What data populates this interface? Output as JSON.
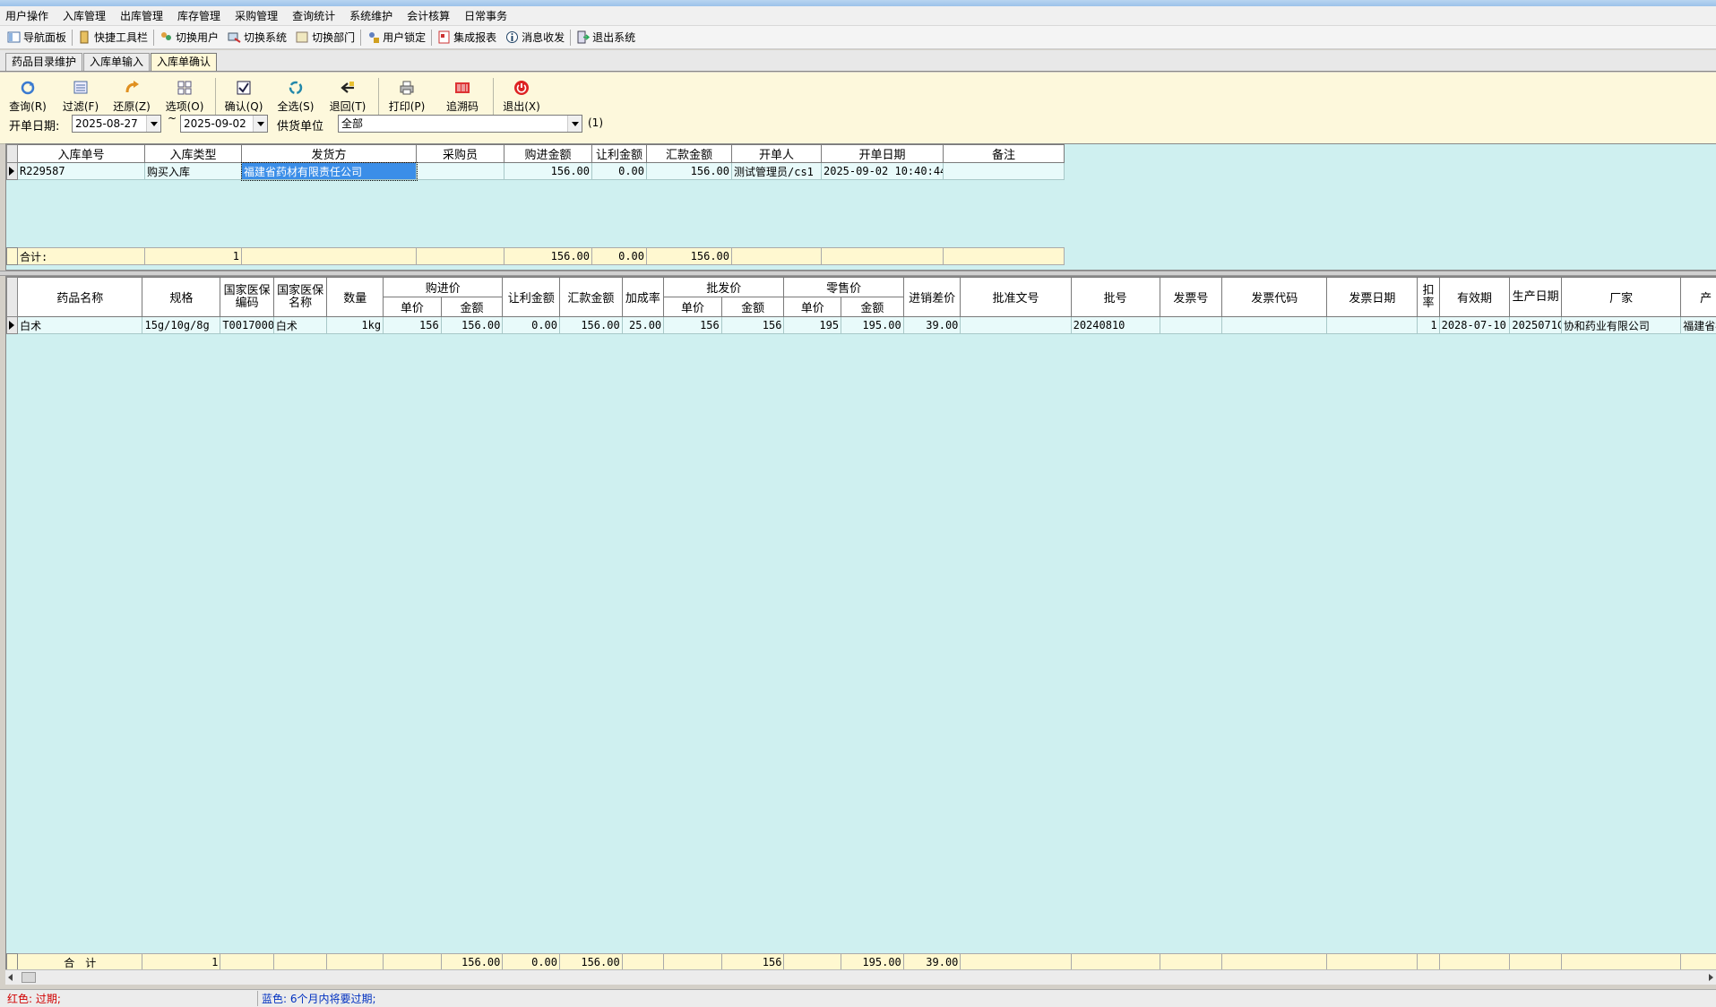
{
  "menu": [
    "用户操作",
    "入库管理",
    "出库管理",
    "库存管理",
    "采购管理",
    "查询统计",
    "系统维护",
    "会计核算",
    "日常事务"
  ],
  "quickbar": [
    {
      "label": "导航面板",
      "icon": "navigation-panel-icon"
    },
    {
      "label": "快捷工具栏",
      "icon": "toolbar-icon"
    },
    {
      "label": "切换用户",
      "icon": "switch-user-icon"
    },
    {
      "label": "切换系统",
      "icon": "switch-system-icon"
    },
    {
      "label": "切换部门",
      "icon": "switch-department-icon"
    },
    {
      "label": "用户锁定",
      "icon": "user-lock-icon"
    },
    {
      "label": "集成报表",
      "icon": "report-icon"
    },
    {
      "label": "消息收发",
      "icon": "message-icon"
    },
    {
      "label": "退出系统",
      "icon": "exit-system-icon"
    }
  ],
  "tabs": [
    "药品目录维护",
    "入库单输入",
    "入库单确认"
  ],
  "toolbar": {
    "query": "查询(R)",
    "filter": "过滤(F)",
    "restore": "还原(Z)",
    "options": "选项(O)",
    "confirm": "确认(Q)",
    "select_all": "全选(S)",
    "return": "退回(T)",
    "print": "打印(P)",
    "trace": "追溯码",
    "exit": "退出(X)"
  },
  "filter": {
    "date_label": "开单日期:",
    "date_from": "2025-08-27",
    "tilde": "~",
    "date_to": "2025-09-02",
    "supplier_label": "供货单位",
    "supplier_value": "全部",
    "count": "(1)"
  },
  "master": {
    "headers": [
      "入库单号",
      "入库类型",
      "发货方",
      "采购员",
      "购进金额",
      "让利金额",
      "汇款金额",
      "开单人",
      "开单日期",
      "备注"
    ],
    "rows": [
      {
        "no": "R229587",
        "type": "购买入库",
        "shipper": "福建省药材有限责任公司",
        "buyer": "",
        "purchase": "156.00",
        "discount": "0.00",
        "remit": "156.00",
        "issuer": "测试管理员/cs1",
        "date": "2025-09-02 10:40:44",
        "note": ""
      }
    ],
    "footer": {
      "label": "合计:",
      "count": "1",
      "purchase": "156.00",
      "discount": "0.00",
      "remit": "156.00"
    }
  },
  "detail": {
    "headers": {
      "name": "药品名称",
      "spec": "规格",
      "nhsa_code": "国家医保编码",
      "nhsa_name": "国家医保名称",
      "qty": "数量",
      "purchase_price": "购进价",
      "unit": "单价",
      "amount": "金额",
      "discount": "让利金额",
      "remit": "汇款金额",
      "markup": "加成率",
      "wholesale": "批发价",
      "retail": "零售价",
      "diff": "进销差价",
      "approval": "批准文号",
      "batch": "批号",
      "invoice_no": "发票号",
      "invoice_code": "发票代码",
      "invoice_date": "发票日期",
      "rate": "扣率",
      "expiry": "有效期",
      "mfg_date": "生产日期",
      "manufacturer": "厂家",
      "last": "产"
    },
    "rows": [
      {
        "name": "白术",
        "spec": "15g/10g/8g",
        "nhsa_code": "T0017000",
        "nhsa_name": "白术",
        "qty": "1kg",
        "pp_unit": "156",
        "pp_amount": "156.00",
        "discount": "0.00",
        "remit": "156.00",
        "markup": "25.00",
        "ws_unit": "156",
        "ws_amount": "156",
        "rt_unit": "195",
        "rt_amount": "195.00",
        "diff": "39.00",
        "approval": "",
        "batch": "20240810",
        "invoice_no": "",
        "invoice_code": "",
        "invoice_date": "",
        "rate": "1",
        "expiry": "2028-07-10",
        "mfg_date": "2025071C",
        "manufacturer": "协和药业有限公司",
        "last": "福建省福"
      }
    ],
    "footer": {
      "label": "合　计",
      "count": "1",
      "pp_amount": "156.00",
      "discount": "0.00",
      "remit": "156.00",
      "ws_amount": "156",
      "rt_amount": "195.00",
      "diff": "39.00"
    }
  },
  "status": {
    "red": "红色: 过期;",
    "blue": "蓝色: 6个月内将要过期;"
  },
  "colors": {
    "grid_bg": "#cff0f0",
    "toolbar_bg": "#fdf8dc",
    "footer_bg": "#fff8d0",
    "selection": "#3b8ee8"
  }
}
